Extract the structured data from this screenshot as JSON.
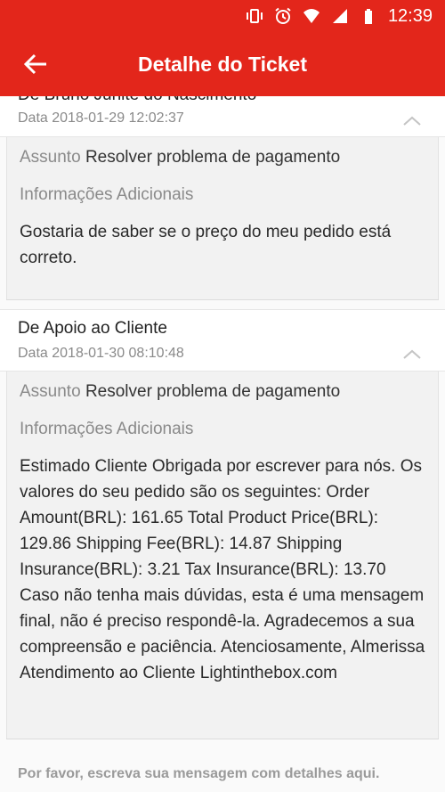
{
  "status_bar": {
    "time": "12:39"
  },
  "app_bar": {
    "title": "Detalhe do Ticket"
  },
  "messages": [
    {
      "from": "De Bruno Junite do Nascimento",
      "date": "Data 2018-01-29 12:02:37",
      "subject_label": "Assunto",
      "subject": "Resolver problema de pagamento",
      "info_label": "Informações Adicionais",
      "body": "Gostaria de saber se o preço do meu pedido está correto."
    },
    {
      "from": "De Apoio ao Cliente",
      "date": "Data 2018-01-30 08:10:48",
      "subject_label": "Assunto",
      "subject": "Resolver problema de pagamento",
      "info_label": "Informações Adicionais",
      "body": "Estimado Cliente Obrigada por escrever para nós. Os valores do seu pedido são os seguintes: Order Amount(BRL): 161.65 Total Product Price(BRL): 129.86 Shipping Fee(BRL): 14.87 Shipping Insurance(BRL): 3.21 Tax Insurance(BRL): 13.70 Caso não tenha mais dúvidas, esta é uma mensagem final, não é preciso respondê-la. Agradecemos a sua compreensão e paciência. Atenciosamente, Almerissa Atendimento ao Cliente Lightinthebox.com"
    }
  ],
  "reply": {
    "placeholder": "Por favor, escreva sua mensagem com detalhes aqui."
  },
  "colors": {
    "primary": "#e3261b",
    "card_bg": "#f2f2f2",
    "muted": "#8a8a8a"
  },
  "icons": [
    "vibrate-icon",
    "alarm-icon",
    "wifi-icon",
    "signal-icon",
    "battery-icon",
    "back-arrow-icon",
    "chevron-up-icon"
  ]
}
